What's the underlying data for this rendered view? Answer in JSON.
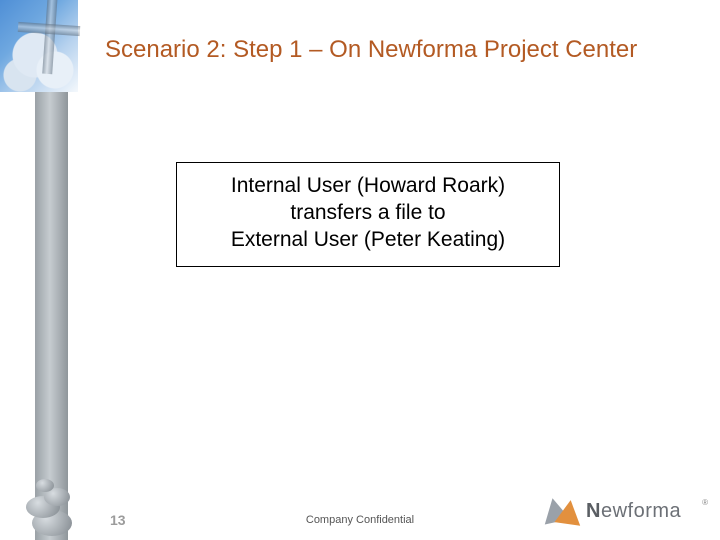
{
  "title": "Scenario 2: Step 1 – On Newforma Project Center",
  "callout": {
    "line1": "Internal User (Howard Roark)",
    "line2": "transfers a file to",
    "line3": "External User (Peter Keating)"
  },
  "footer": {
    "page_number": "13",
    "confidential": "Company Confidential"
  },
  "branding": {
    "logo_text_bold": "N",
    "logo_text_rest": "ewforma",
    "registered": "®"
  }
}
